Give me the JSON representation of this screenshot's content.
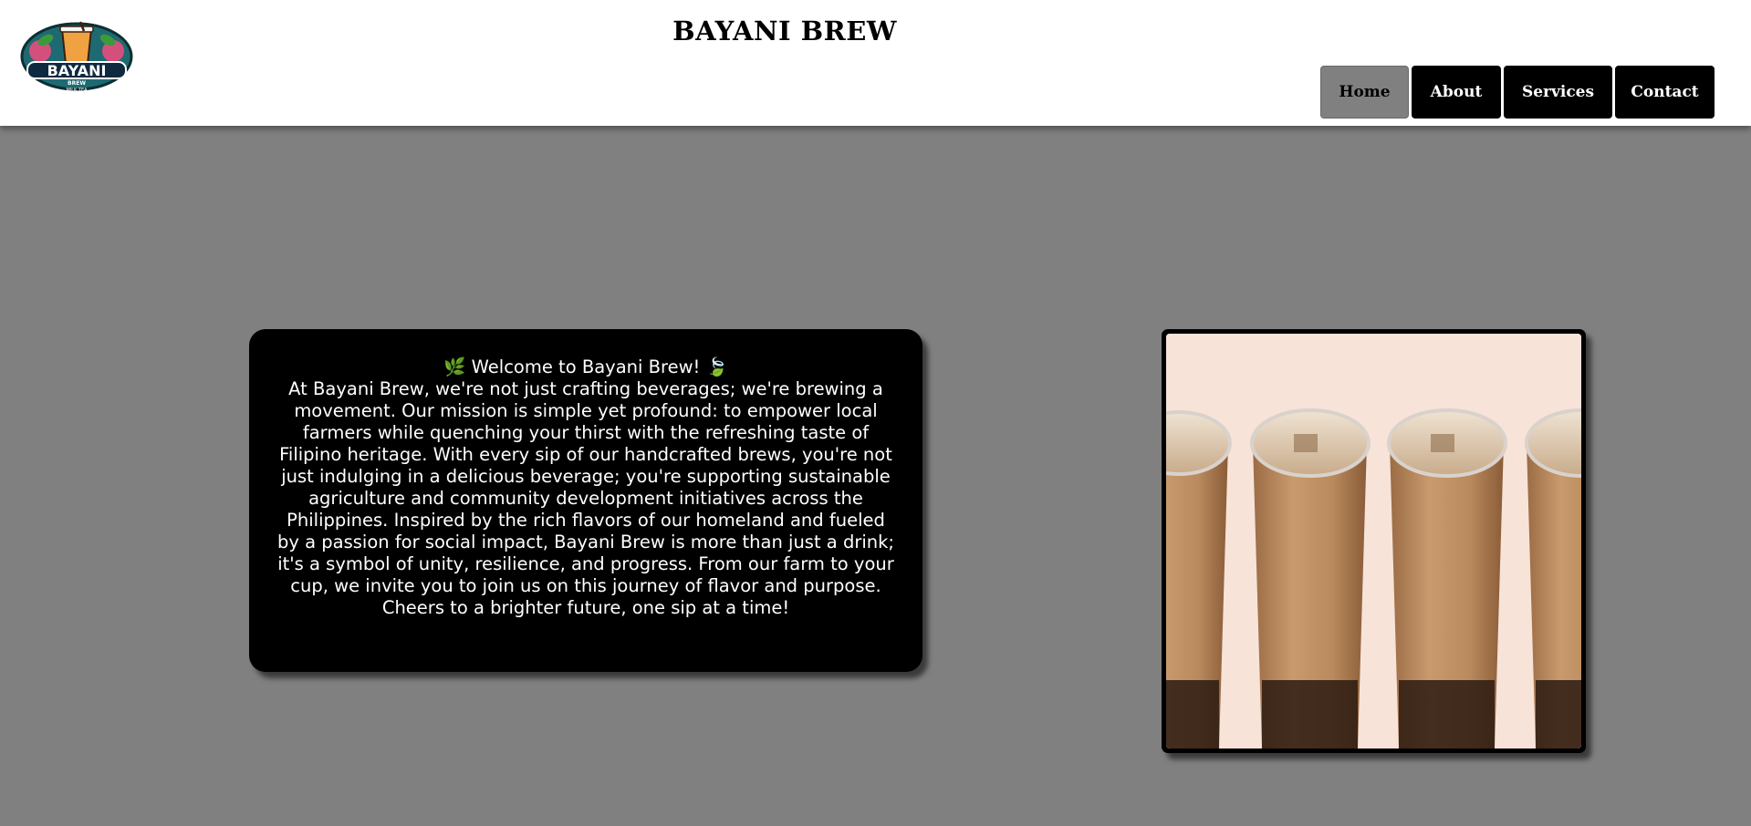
{
  "header": {
    "title": "BAYANI BREW",
    "logo": {
      "name": "BAYANI",
      "sub1": "BREW",
      "sub2": "MILK TEA"
    }
  },
  "nav": {
    "items": [
      {
        "label": "Home",
        "active": true
      },
      {
        "label": "About",
        "active": false
      },
      {
        "label": "Services",
        "active": false
      },
      {
        "label": "Contact",
        "active": false
      }
    ]
  },
  "welcome": {
    "heading": "🌿 Welcome to Bayani Brew! 🍃",
    "body": "At Bayani Brew, we're not just crafting beverages; we're brewing a movement. Our mission is simple yet profound: to empower local farmers while quenching your thirst with the refreshing taste of Filipino heritage. With every sip of our handcrafted brews, you're not just indulging in a delicious beverage; you're supporting sustainable agriculture and community development initiatives across the Philippines. Inspired by the rich flavors of our homeland and fueled by a passion for social impact, Bayani Brew is more than just a drink; it's a symbol of unity, resilience, and progress. From our farm to your cup, we invite you to join us on this journey of flavor and purpose. Cheers to a brighter future, one sip at a time!"
  },
  "hero_image": {
    "subject": "iced milk tea cups"
  },
  "colors": {
    "page_bg": "#808080",
    "header_bg": "#ffffff",
    "nav_bg": "#000000",
    "nav_active_bg": "#808080",
    "card_bg": "#000000",
    "photo_bg": "#f7e3d8"
  }
}
